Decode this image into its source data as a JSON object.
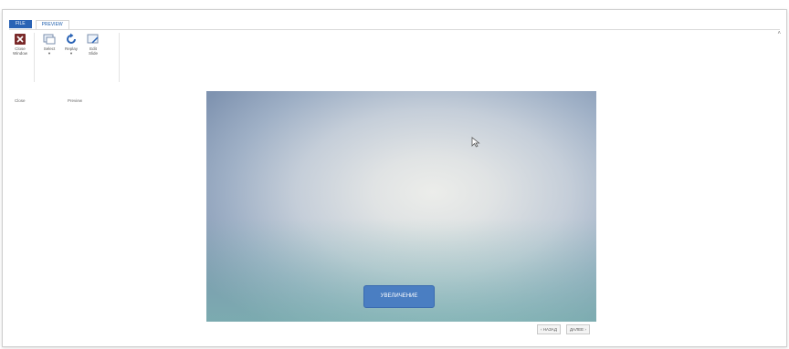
{
  "tabs": {
    "file": "FILE",
    "preview": "PREVIEW"
  },
  "ribbon": {
    "close_label": "Close\nWindow",
    "close_group": "Close",
    "select_label": "Select\n▾",
    "replay_label": "Replay\n▾",
    "edit_label": "Edit\nSlide",
    "preview_group": "Preview",
    "collapse_caret": "˄"
  },
  "slide": {
    "zoom_button_label": "УВЕЛИЧЕНИЕ"
  },
  "player": {
    "back_label": "‹ НАЗАД",
    "next_label": "ДАЛЕЕ ›"
  },
  "colors": {
    "accent": "#2a63b5",
    "button": "#4a7ec2"
  }
}
